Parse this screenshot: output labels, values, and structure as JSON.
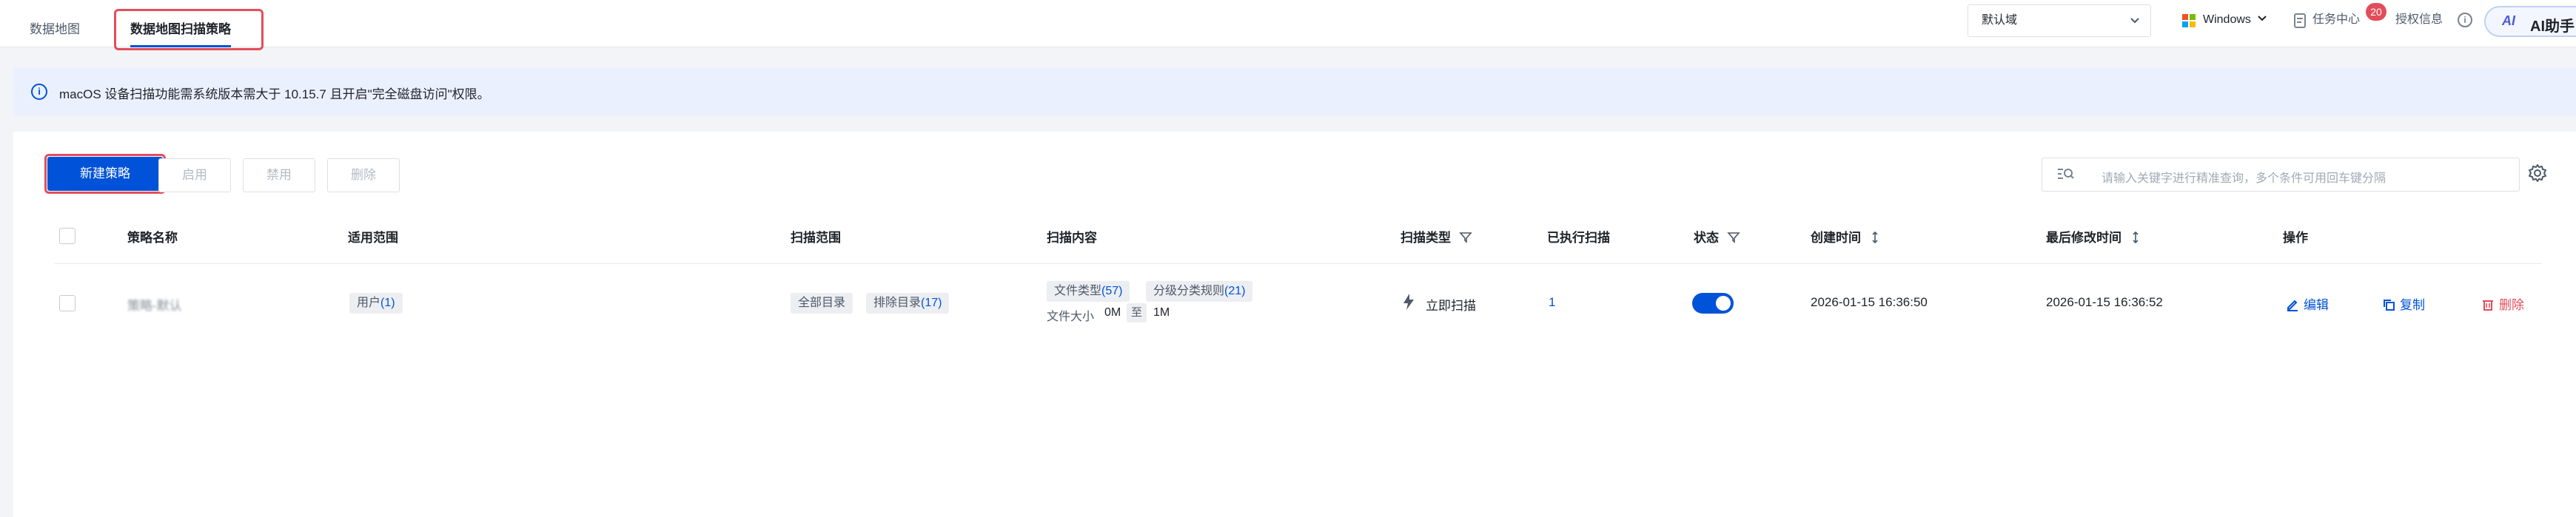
{
  "tabs": [
    {
      "label": "数据地图"
    },
    {
      "label": "数据地图扫描策略"
    }
  ],
  "header": {
    "domain_select": "默认域",
    "os_select": "Windows",
    "task_center": "任务中心",
    "task_badge": "20",
    "license_info": "授权信息",
    "info_glyph": "i",
    "ai_logo": "AI",
    "ai_assistant": "AI助手"
  },
  "notice": {
    "text": "macOS 设备扫描功能需系统版本需大于 10.15.7 且开启\"完全磁盘访问\"权限。"
  },
  "toolbar": {
    "new_policy": "新建策略",
    "enable": "启用",
    "disable": "禁用",
    "delete": "删除",
    "search_placeholder": "请输入关键字进行精准查询，多个条件可用回车键分隔"
  },
  "table": {
    "columns": [
      "策略名称",
      "适用范围",
      "扫描范围",
      "扫描内容",
      "扫描类型",
      "已执行扫描",
      "状态",
      "创建时间",
      "最后修改时间",
      "操作"
    ],
    "rows": [
      {
        "name": "策略-默认",
        "scope_label": "用户",
        "scope_count": "(1)",
        "scan_range_all": "全部目录",
        "exclude_label": "排除目录",
        "exclude_count": "(17)",
        "file_type_label": "文件类型",
        "file_type_count": "(57)",
        "class_rule_label": "分级分类规则",
        "class_rule_count": "(21)",
        "file_size_label": "文件大小",
        "size_min": "0M",
        "size_to": "至",
        "size_max": "1M",
        "scan_type": "立即扫描",
        "executed": "1",
        "status_on": true,
        "created": "2026-01-15 16:36:50",
        "modified": "2026-01-15 16:36:52",
        "action_edit": "编辑",
        "action_copy": "复制",
        "action_delete": "删除"
      }
    ]
  },
  "colors": {
    "primary": "#0052d9",
    "danger": "#e34d59",
    "notice_bg": "#eaf0fd"
  }
}
